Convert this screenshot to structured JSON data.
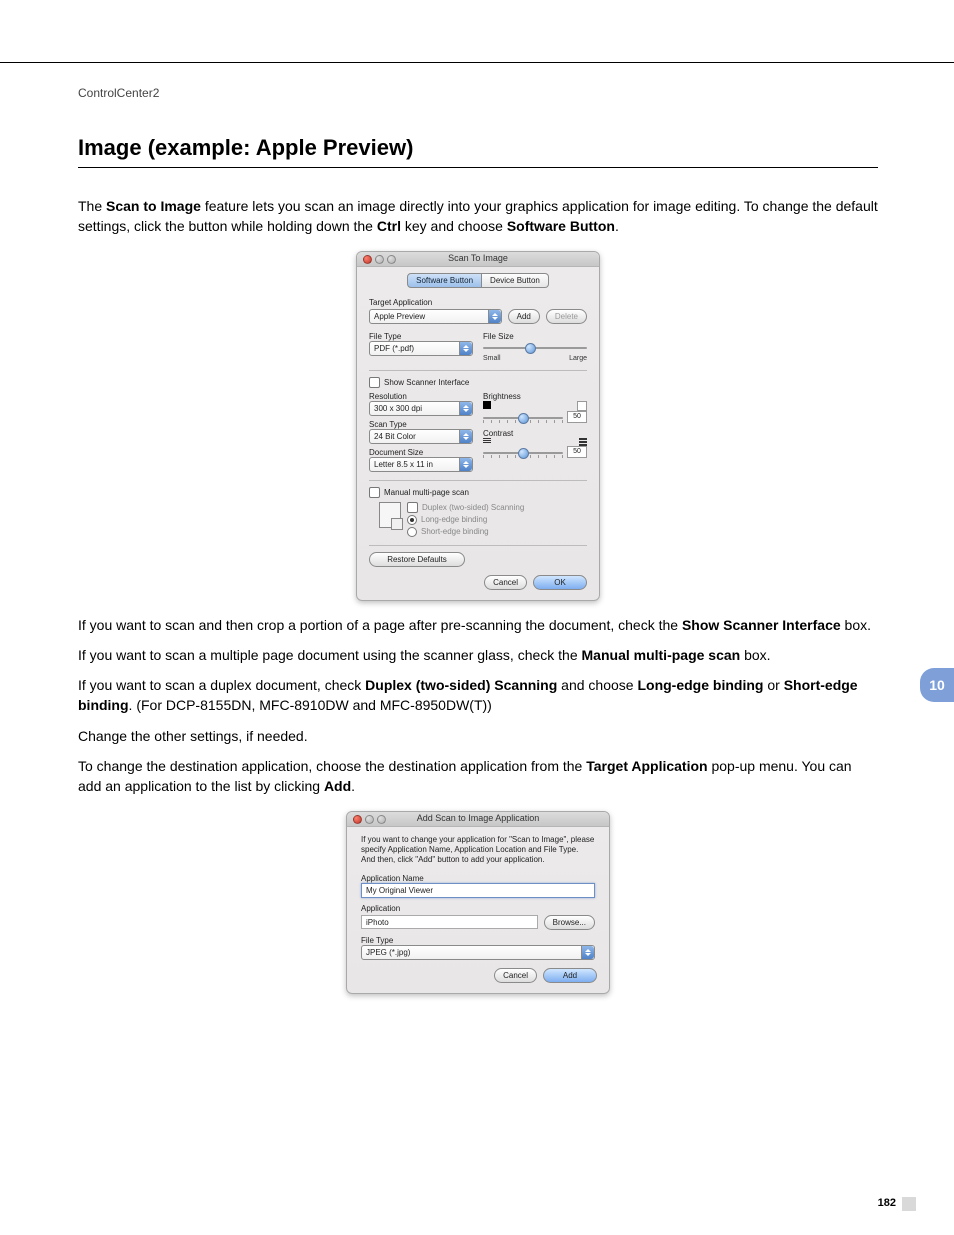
{
  "breadcrumb": "ControlCenter2",
  "heading": "Image (example: Apple Preview)",
  "intro": {
    "p1_a": "The ",
    "p1_b": "Scan to Image",
    "p1_c": " feature lets you scan an image directly into your graphics application for image editing. To change the default settings, click the button while holding down the ",
    "p1_d": "Ctrl",
    "p1_e": " key and choose ",
    "p1_f": "Software Button",
    "p1_g": "."
  },
  "after1": {
    "p2_a": "If you want to scan and then crop a portion of a page after pre-scanning the document, check the ",
    "p2_b": "Show Scanner Interface",
    "p2_c": " box.",
    "p3_a": "If you want to scan a multiple page document using the scanner glass, check the ",
    "p3_b": "Manual multi-page scan",
    "p3_c": " box.",
    "p4_a": "If you want to scan a duplex document, check ",
    "p4_b": "Duplex (two-sided) Scanning",
    "p4_c": " and choose ",
    "p4_d": "Long-edge binding",
    "p4_e": " or ",
    "p4_f": "Short-edge binding",
    "p4_g": ". (For DCP-8155DN, MFC-8910DW and MFC-8950DW(T))",
    "p5": "Change the other settings, if needed.",
    "p6_a": "To change the destination application, choose the destination application from the ",
    "p6_b": "Target Application",
    "p6_c": " pop-up menu. You can add an application to the list by clicking ",
    "p6_d": "Add",
    "p6_e": "."
  },
  "chapter": "10",
  "page_number": "182",
  "dlg1": {
    "title": "Scan To Image",
    "tab_software": "Software Button",
    "tab_device": "Device Button",
    "target_app_label": "Target Application",
    "target_app_value": "Apple Preview",
    "add_btn": "Add",
    "delete_btn": "Delete",
    "file_type_label": "File Type",
    "file_type_value": "PDF (*.pdf)",
    "file_size_label": "File Size",
    "small": "Small",
    "large": "Large",
    "show_scanner": "Show Scanner Interface",
    "resolution_label": "Resolution",
    "resolution_value": "300 x 300 dpi",
    "scan_type_label": "Scan Type",
    "scan_type_value": "24 Bit Color",
    "doc_size_label": "Document Size",
    "doc_size_value": "Letter  8.5 x 11 in",
    "brightness_label": "Brightness",
    "brightness_value": "50",
    "contrast_label": "Contrast",
    "contrast_value": "50",
    "manual_multi": "Manual multi-page scan",
    "duplex": "Duplex (two-sided) Scanning",
    "long_edge": "Long-edge binding",
    "short_edge": "Short-edge binding",
    "restore": "Restore Defaults",
    "cancel": "Cancel",
    "ok": "OK"
  },
  "dlg2": {
    "title": "Add Scan to Image Application",
    "desc": "If you want to change your application for \"Scan to Image\", please specify Application Name, Application Location and File Type.\nAnd then, click \"Add\" button to add your application.",
    "app_name_label": "Application Name",
    "app_name_value": "My Original Viewer",
    "application_label": "Application",
    "application_value": "iPhoto",
    "browse": "Browse...",
    "file_type_label": "File Type",
    "file_type_value": "JPEG (*.jpg)",
    "cancel": "Cancel",
    "add": "Add"
  }
}
